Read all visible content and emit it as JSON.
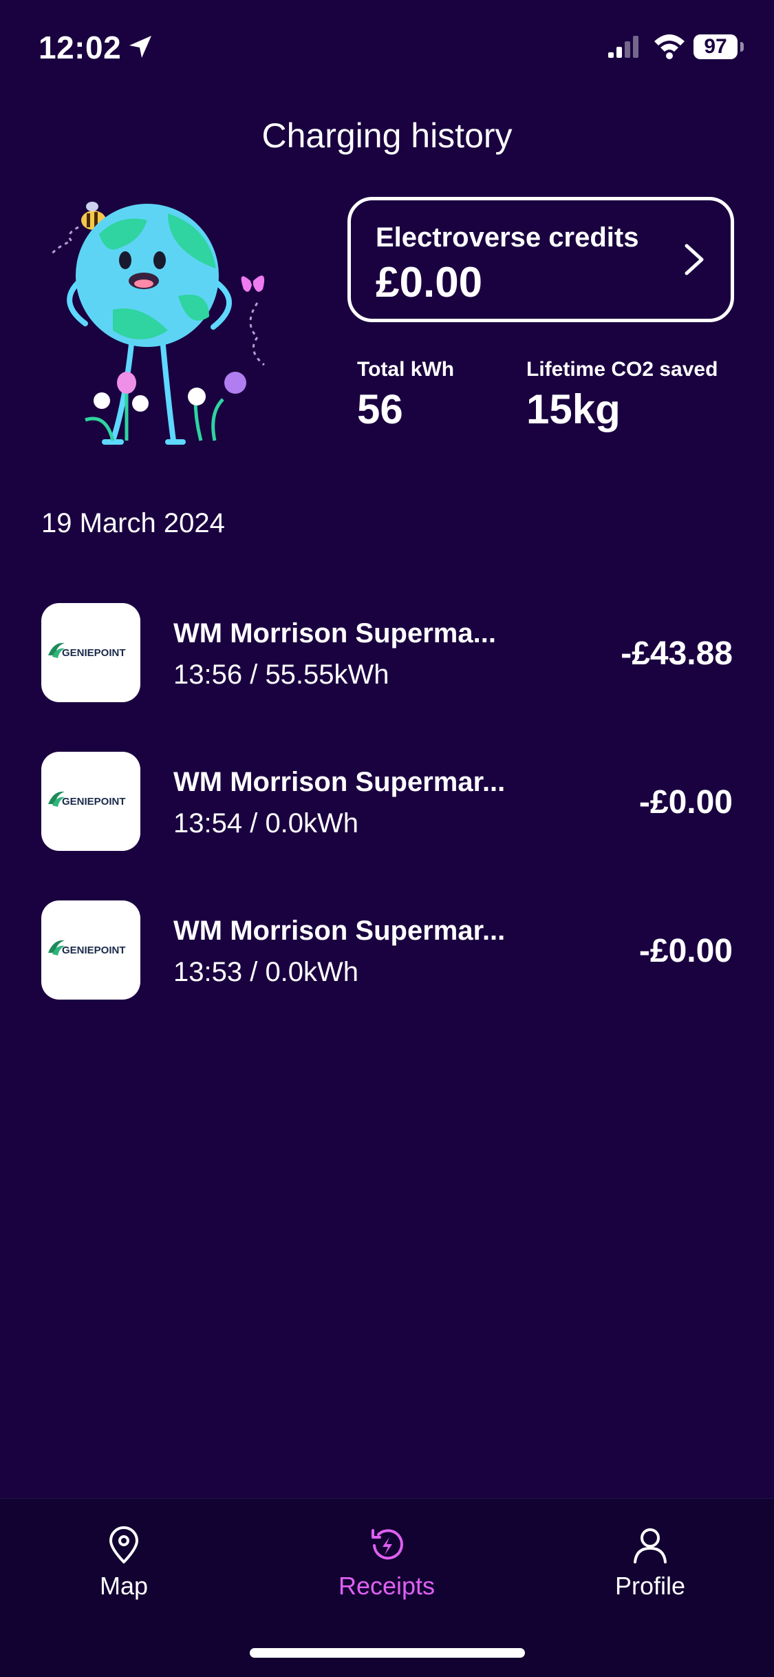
{
  "status_bar": {
    "time": "12:02",
    "battery": "97",
    "icons": [
      "location-arrow-icon",
      "signal-icon",
      "wifi-icon",
      "battery-icon"
    ]
  },
  "page": {
    "title": "Charging history"
  },
  "credits": {
    "label": "Electroverse credits",
    "value": "£0.00"
  },
  "stats": {
    "total_kwh_label": "Total kWh",
    "total_kwh_value": "56",
    "co2_label": "Lifetime CO2 saved",
    "co2_value": "15kg"
  },
  "history": {
    "date": "19 March 2024",
    "items": [
      {
        "title": "WM Morrison Superma...",
        "details": "13:56 / 55.55kWh",
        "amount": "-£43.88",
        "logo_text": "GENIEPOINT"
      },
      {
        "title": "WM Morrison Supermar...",
        "details": "13:54 / 0.0kWh",
        "amount": "-£0.00",
        "logo_text": "GENIEPOINT"
      },
      {
        "title": "WM Morrison Supermar...",
        "details": "13:53 / 0.0kWh",
        "amount": "-£0.00",
        "logo_text": "GENIEPOINT"
      }
    ]
  },
  "tabbar": {
    "tabs": [
      {
        "label": "Map",
        "icon": "map-pin-icon",
        "active": false
      },
      {
        "label": "Receipts",
        "icon": "receipts-icon",
        "active": true
      },
      {
        "label": "Profile",
        "icon": "profile-icon",
        "active": false
      }
    ]
  },
  "colors": {
    "background": "#1a0240",
    "tabbar_background": "#120232",
    "accent": "#e060f2",
    "text": "#ffffff"
  }
}
